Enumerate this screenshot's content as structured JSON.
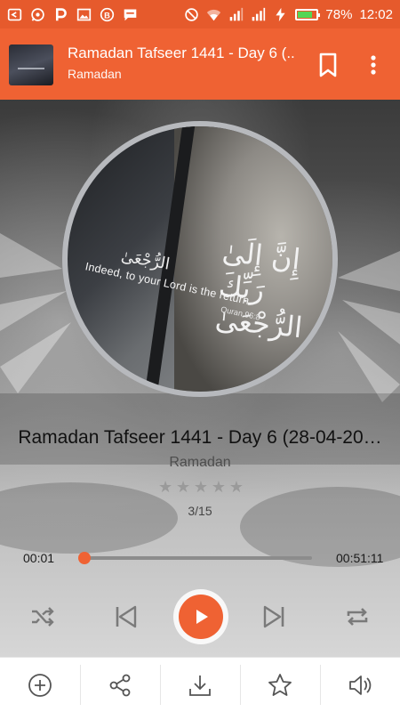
{
  "status_bar": {
    "battery": "78%",
    "battery_level": 0.78,
    "time": "12:02",
    "left_icons": [
      "back-arrow-icon",
      "whatsapp-icon",
      "p-app-icon",
      "image-icon",
      "b-coin-icon",
      "message-icon"
    ],
    "right_icons": [
      "dnd-icon",
      "wifi-icon",
      "signal-icon",
      "signal-icon",
      "charging-icon",
      "battery-icon"
    ]
  },
  "app_bar": {
    "title": "Ramadan Tafseer 1441 - Day 6 (..",
    "subtitle": "Ramadan",
    "icons": [
      "bookmark-icon",
      "more-vert-icon"
    ]
  },
  "artwork": {
    "arabic_text": "إِنَّ إِلَىٰ رَبِّكَ الرُّجْعَىٰ",
    "arabic_small": "الرُّجْعَىٰ",
    "quote": "Indeed, to your Lord is the return.",
    "citation": "Quran 96:8"
  },
  "track": {
    "title": "Ramadan Tafseer 1441 - Day 6 (28-04-20…",
    "artist": "Ramadan",
    "rating": 0,
    "rating_max": 5,
    "position_label": "3/15"
  },
  "seek": {
    "elapsed": "00:01",
    "duration": "00:51:11",
    "progress": 0.0003
  },
  "controls": {
    "icons": [
      "shuffle-icon",
      "skip-previous-icon",
      "play-icon",
      "skip-next-icon",
      "repeat-icon"
    ],
    "accent": "#ef6233"
  },
  "bottom_bar": {
    "icons": [
      "add-circle-icon",
      "share-icon",
      "download-icon",
      "star-icon",
      "volume-icon"
    ]
  },
  "colors": {
    "status_bar": "#e65a2c",
    "app_bar": "#ef6233",
    "accent": "#ef6233"
  }
}
